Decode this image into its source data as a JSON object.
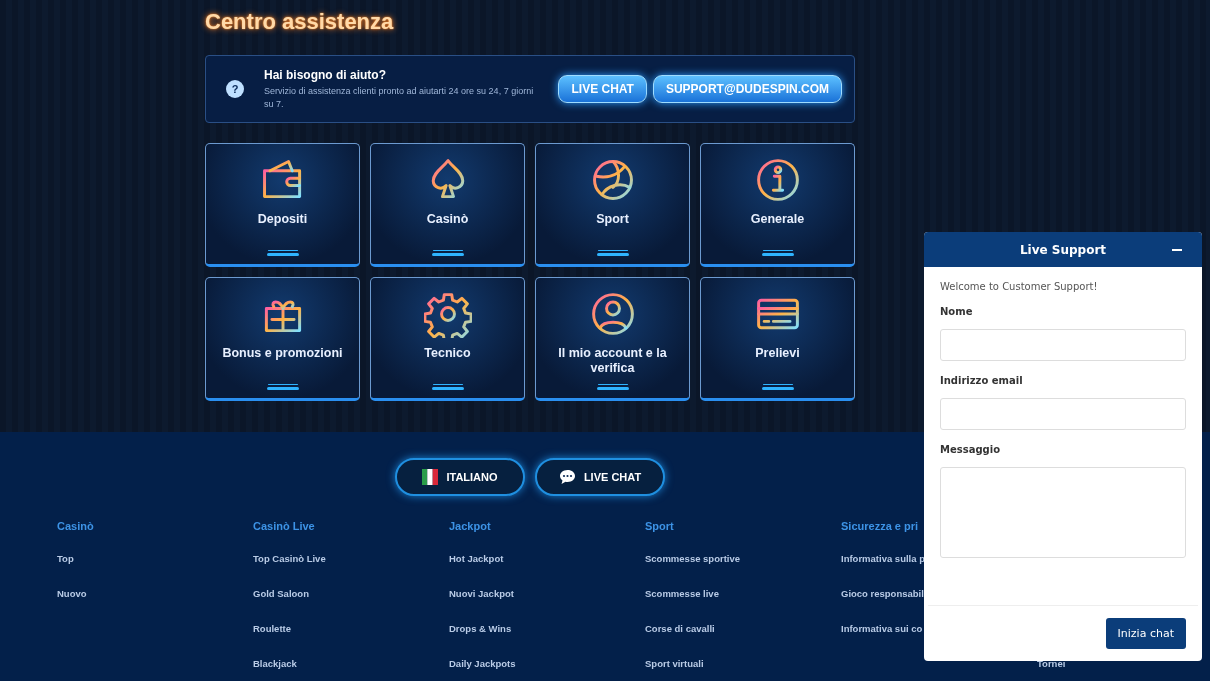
{
  "page_title": "Centro assistenza",
  "help_banner": {
    "icon": "?",
    "title": "Hai bisogno di aiuto?",
    "text": "Servizio di assistenza clienti pronto ad aiutarti 24 ore su 24, 7 giorni su 7.",
    "buttons": [
      "LIVE CHAT",
      "SUPPORT@DUDESPIN.COM"
    ]
  },
  "categories": [
    {
      "label": "Depositi"
    },
    {
      "label": "Casinò"
    },
    {
      "label": "Sport"
    },
    {
      "label": "Generale"
    },
    {
      "label": "Bonus e promozioni"
    },
    {
      "label": "Tecnico"
    },
    {
      "label": "Il mio account e la verifica"
    },
    {
      "label": "Prelievi"
    }
  ],
  "footer_buttons": [
    {
      "label": "ITALIANO"
    },
    {
      "label": "LIVE CHAT"
    }
  ],
  "footer_columns": [
    {
      "heading": "Casinò",
      "links": [
        "Top",
        "Nuovo"
      ]
    },
    {
      "heading": "Casinò Live",
      "links": [
        "Top Casinò Live",
        "Gold Saloon",
        "Roulette",
        "Blackjack"
      ]
    },
    {
      "heading": "Jackpot",
      "links": [
        "Hot Jackpot",
        "Nuovi Jackpot",
        "Drops & Wins",
        "Daily Jackpots"
      ]
    },
    {
      "heading": "Sport",
      "links": [
        "Scommesse sportive",
        "Scommesse live",
        "Corse di cavalli",
        "Sport virtuali"
      ]
    },
    {
      "heading": "Sicurezza e pri",
      "links": [
        "Informativa sulla p",
        "Gioco responsabil",
        "Informativa sui co"
      ]
    },
    {
      "links": [
        "Tornei"
      ]
    }
  ],
  "chat_widget": {
    "title": "Live Support",
    "welcome": "Welcome to Customer Support!",
    "fields": [
      {
        "label": "Nome",
        "kind": "line"
      },
      {
        "label": "Indirizzo email",
        "kind": "line"
      },
      {
        "label": "Messaggio",
        "kind": "area"
      }
    ],
    "submit": "Inizia chat"
  }
}
